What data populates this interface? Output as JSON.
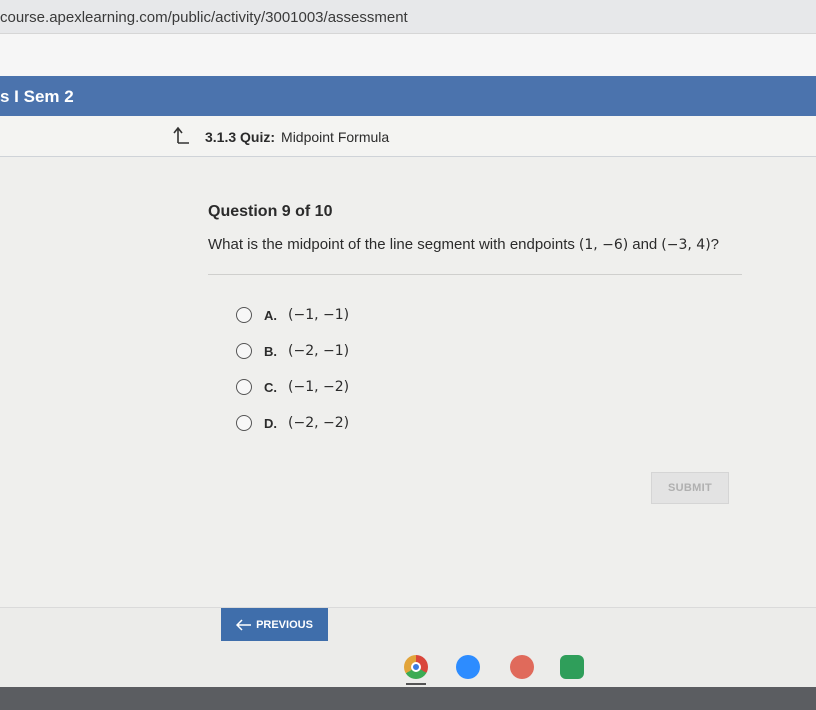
{
  "browser": {
    "url": "course.apexlearning.com/public/activity/3001003/assessment"
  },
  "course": {
    "title": "s I Sem 2"
  },
  "quiz": {
    "code": "3.1.3 Quiz:",
    "name": "Midpoint Formula"
  },
  "question": {
    "number_label": "Question 9 of 10",
    "prompt_before": "What is the midpoint of the line segment with endpoints",
    "point1": "(1, −6)",
    "conjunction": "and",
    "point2": "(−3, 4)",
    "prompt_after": "?"
  },
  "options": [
    {
      "letter": "A.",
      "value": "(−1, −1)"
    },
    {
      "letter": "B.",
      "value": "(−2, −1)"
    },
    {
      "letter": "C.",
      "value": "(−1, −2)"
    },
    {
      "letter": "D.",
      "value": "(−2, −2)"
    }
  ],
  "actions": {
    "submit_label": "SUBMIT",
    "previous_label": "PREVIOUS"
  },
  "taskbar": {
    "icons": [
      "chrome-icon",
      "zoom-icon",
      "app-icon",
      "classroom-icon"
    ],
    "colors": {
      "chrome": "#e2a43a",
      "zoom": "#2d8cff",
      "app": "#e06a5b",
      "classroom": "#2f9e5a"
    }
  }
}
